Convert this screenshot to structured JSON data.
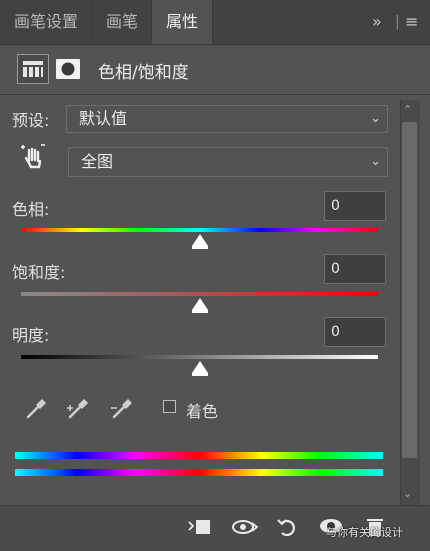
{
  "tabs": [
    {
      "label": "画笔设置",
      "active": false
    },
    {
      "label": "画笔",
      "active": false
    },
    {
      "label": "属性",
      "active": true
    }
  ],
  "tab_menu_icons": [
    "double-chevron-right-icon",
    "panel-menu-icon"
  ],
  "panel": {
    "title": "色相/饱和度",
    "adjustment_icon": "hue-saturation-adjustment-icon",
    "mask_icon": "layer-mask-icon"
  },
  "preset": {
    "label": "预设:",
    "value": "默认值"
  },
  "channel": {
    "value": "全图"
  },
  "sliders": [
    {
      "name": "hue",
      "label": "色相:",
      "value": "0",
      "position_fraction": 0.5
    },
    {
      "name": "saturation",
      "label": "饱和度:",
      "value": "0",
      "position_fraction": 0.5
    },
    {
      "name": "lightness",
      "label": "明度:",
      "value": "0",
      "position_fraction": 0.5
    }
  ],
  "colorize": {
    "label": "着色",
    "checked": false
  },
  "footer_icons": [
    "clip-to-layer-icon",
    "view-previous-state-icon",
    "reset-icon",
    "visibility-eye-icon",
    "delete-icon"
  ],
  "watermark": "与你有关的设计",
  "colors": {
    "background": "#535353",
    "tab_bar": "#424242",
    "accent_text": "#e6e6e6"
  }
}
